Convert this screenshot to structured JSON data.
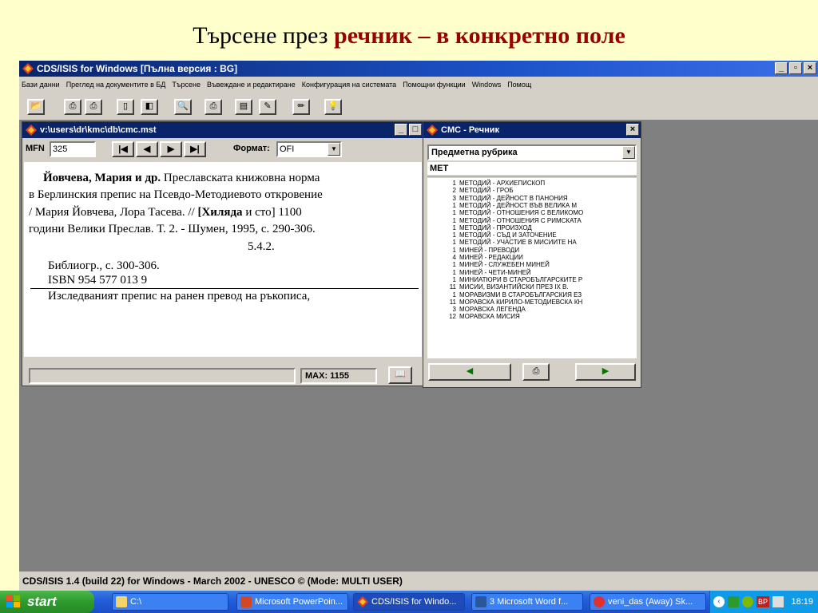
{
  "slide": {
    "title_plain": "Търсене през ",
    "title_highlight": "речник – в конкретно поле"
  },
  "app": {
    "title": "CDS/ISIS for Windows [Пълна версия : BG]",
    "menu": [
      "Бази данни",
      "Преглед на документите в БД",
      "Търсене",
      "Въвеждане и редактиране",
      "Конфигурация на системата",
      "Помощни функции",
      "Windows",
      "Помощ"
    ],
    "status": "CDS/ISIS 1.4 (build 22) for Windows - March 2002 - UNESCO © (Mode: MULTI USER)"
  },
  "record_window": {
    "title": "v:\\users\\dr\\kmc\\db\\cmc.mst",
    "mfn_label": "MFN",
    "mfn_value": "325",
    "format_label": "Формат:",
    "format_value": "OFI",
    "max_label": "MAX: 1155",
    "lines": {
      "l1_bold": "Йовчева, Мария и др.",
      "l1_rest": " Преславската книжовна норма",
      "l2": "в Берлинския препис на Псевдо-Методиевото откровение",
      "l3_a": "/ Мария Йовчева, Лора Тасева. // ",
      "l3_bold": "[Хиляда",
      "l3_b": " и сто] 1100",
      "l4": "години Велики Преслав. Т. 2. - Шумен, 1995, с. 290-306.",
      "l5": "5.4.2.",
      "l6": "Библиогр., с. 300-306.",
      "l7": "ISBN 954 577 013 9",
      "l8": "Изследваният препис на ранен превод на ръкописа,"
    }
  },
  "dictionary_window": {
    "title": "CMC - Речник",
    "field": "Предметна рубрика",
    "search_term": "МЕТ",
    "terms": [
      {
        "count": "1",
        "term": "МЕТОДИЙ - АРХИЕПИСКОП"
      },
      {
        "count": "2",
        "term": "МЕТОДИЙ - ГРОБ"
      },
      {
        "count": "3",
        "term": "МЕТОДИЙ - ДЕЙНОСТ В ПАНОНИЯ"
      },
      {
        "count": "1",
        "term": "МЕТОДИЙ - ДЕЙНОСТ ВЪВ ВЕЛИКА М"
      },
      {
        "count": "1",
        "term": "МЕТОДИЙ - ОТНОШЕНИЯ С ВЕЛИКОМО"
      },
      {
        "count": "1",
        "term": "МЕТОДИЙ - ОТНОШЕНИЯ С РИМСКАТА"
      },
      {
        "count": "1",
        "term": "МЕТОДИЙ - ПРОИЗХОД"
      },
      {
        "count": "1",
        "term": "МЕТОДИЙ - СЪД И ЗАТОЧЕНИЕ"
      },
      {
        "count": "1",
        "term": "МЕТОДИЙ - УЧАСТИЕ В МИСИИТЕ НА"
      },
      {
        "count": "1",
        "term": "МИНЕЙ - ПРЕВОДИ"
      },
      {
        "count": "4",
        "term": "МИНЕЙ - РЕДАКЦИИ"
      },
      {
        "count": "1",
        "term": "МИНЕЙ - СЛУЖЕБЕН МИНЕЙ"
      },
      {
        "count": "1",
        "term": "МИНЕЙ - ЧЕТИ-МИНЕЙ"
      },
      {
        "count": "1",
        "term": "МИНИАТЮРИ В СТАРОБЪЛГАРСКИТЕ Р"
      },
      {
        "count": "11",
        "term": "МИСИИ, ВИЗАНТИЙСКИ ПРЕЗ IX В."
      },
      {
        "count": "1",
        "term": "МОРАВИЗМИ В СТАРОБЪЛГАРСКИЯ ЕЗ"
      },
      {
        "count": "11",
        "term": "МОРАВСКА КИРИЛО-МЕТОДИЕВСКА КН"
      },
      {
        "count": "3",
        "term": "МОРАВСКА ЛЕГЕНДА"
      },
      {
        "count": "12",
        "term": "МОРАВСКА МИСИЯ"
      }
    ]
  },
  "taskbar": {
    "start": "start",
    "tasks": [
      "C:\\",
      "Microsoft PowerPoin...",
      "CDS/ISIS for Windo...",
      "3 Microsoft Word f...",
      "veni_das (Away) Sk..."
    ],
    "tray_lang": "BP",
    "clock": "18:19"
  },
  "colors": {
    "title_highlight": "#990000",
    "active_title": "#0a246a",
    "desktop": "#808080",
    "slide_bg": "#ffffcc"
  },
  "icons": [
    "app-diamond-icon",
    "open-folder-icon",
    "print-icon",
    "arrow-left-icon",
    "arrow-right-icon",
    "book-icon",
    "pencil-icon",
    "lightbulb-icon",
    "windows-flag-icon",
    "folder-icon",
    "clock-icon"
  ]
}
